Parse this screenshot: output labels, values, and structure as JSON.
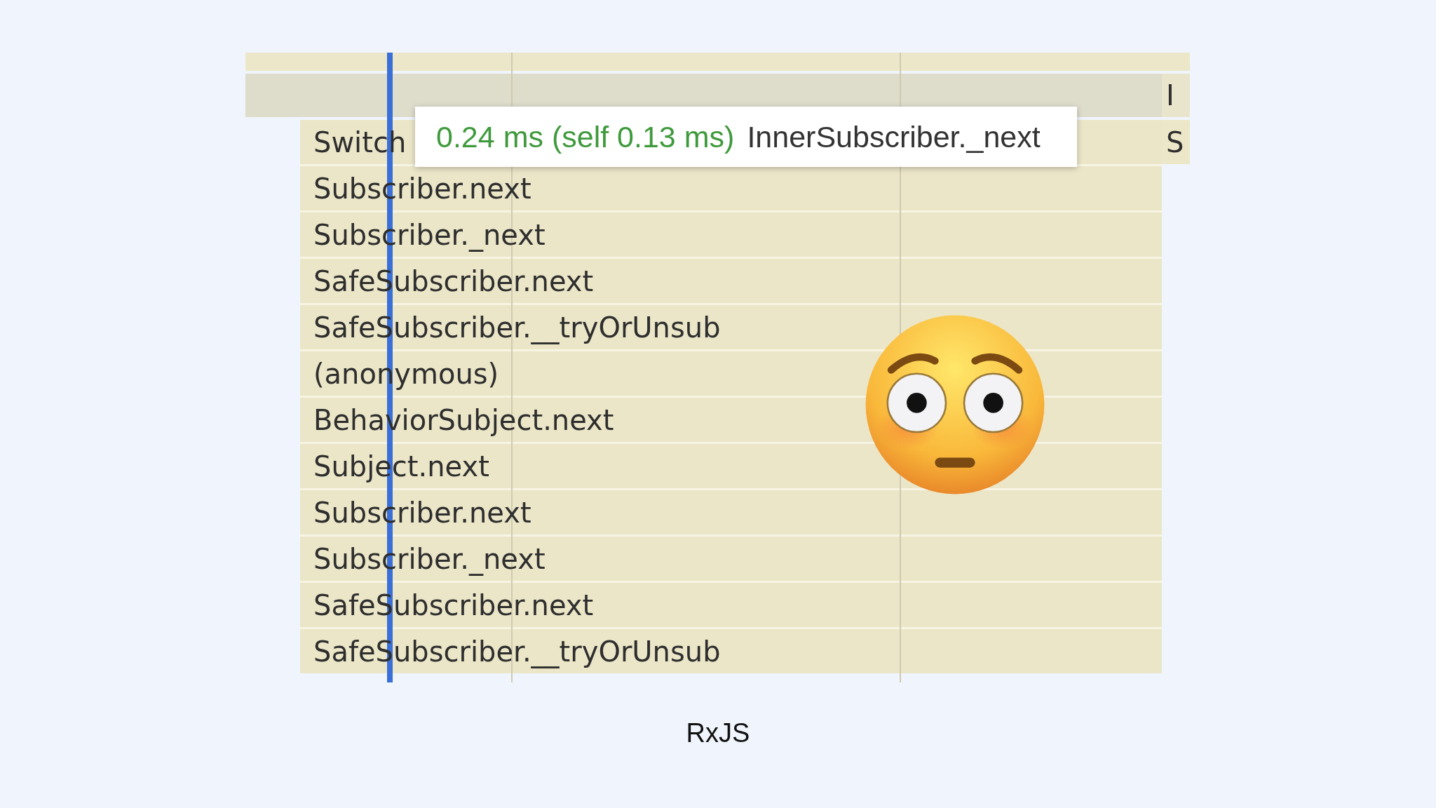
{
  "flame_chart": {
    "rows": [
      "Switch",
      "Subscriber.next",
      "Subscriber._next",
      "SafeSubscriber.next",
      "SafeSubscriber.__tryOrUnsub",
      "(anonymous)",
      "BehaviorSubject.next",
      "Subject.next",
      "Subscriber.next",
      "Subscriber._next",
      "SafeSubscriber.next",
      "SafeSubscriber.__tryOrUnsub"
    ],
    "edge_labels": [
      "I",
      "S"
    ],
    "tooltip": {
      "duration": "0.24 ms (self 0.13 ms)",
      "name": "InnerSubscriber._next"
    }
  },
  "caption": "RxJS"
}
